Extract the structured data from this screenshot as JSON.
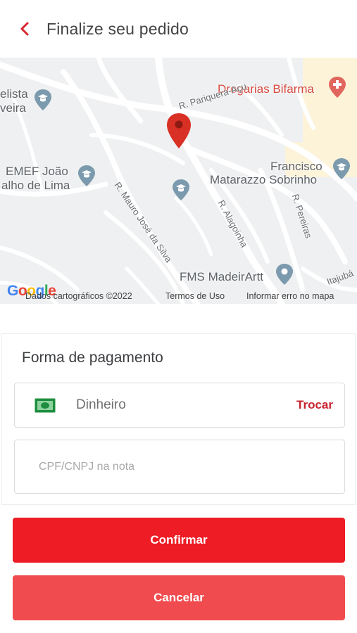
{
  "header": {
    "title": "Finalize seu pedido",
    "back_icon": "chevron-left-icon",
    "accent_color": "#d7262f"
  },
  "map": {
    "labels": {
      "top_left_1": "elista",
      "top_left_2": "veira",
      "emef_1": "EMEF João",
      "emef_2": "alho de Lima",
      "drogarias": "Drogarias Bifarma",
      "francisco_1": "Francisco",
      "francisco_2": "Matarazzo Sobrinho",
      "fms": "FMS MadeirArtt"
    },
    "streets": {
      "pariquera": "R. Pariquera-Açu",
      "mauro": "R. Mauro José da Silva",
      "alagoinha": "R. Alagoinha",
      "pereiras": "R. Pereiras",
      "itajuba": "Itajubá"
    },
    "attribution": {
      "data": "Dados cartográficos ©2022",
      "terms": "Termos de Uso",
      "report": "Informar erro no mapa"
    },
    "pin_color": "#d93025"
  },
  "payment": {
    "title": "Forma de pagamento",
    "method": "Dinheiro",
    "method_icon": "cash-icon",
    "change_label": "Trocar",
    "cpf_placeholder": "CPF/CNPJ na nota"
  },
  "actions": {
    "confirm_label": "Confirmar",
    "cancel_label": "Cancelar",
    "confirm_color": "#ee1c25",
    "cancel_color": "#f04c50"
  }
}
